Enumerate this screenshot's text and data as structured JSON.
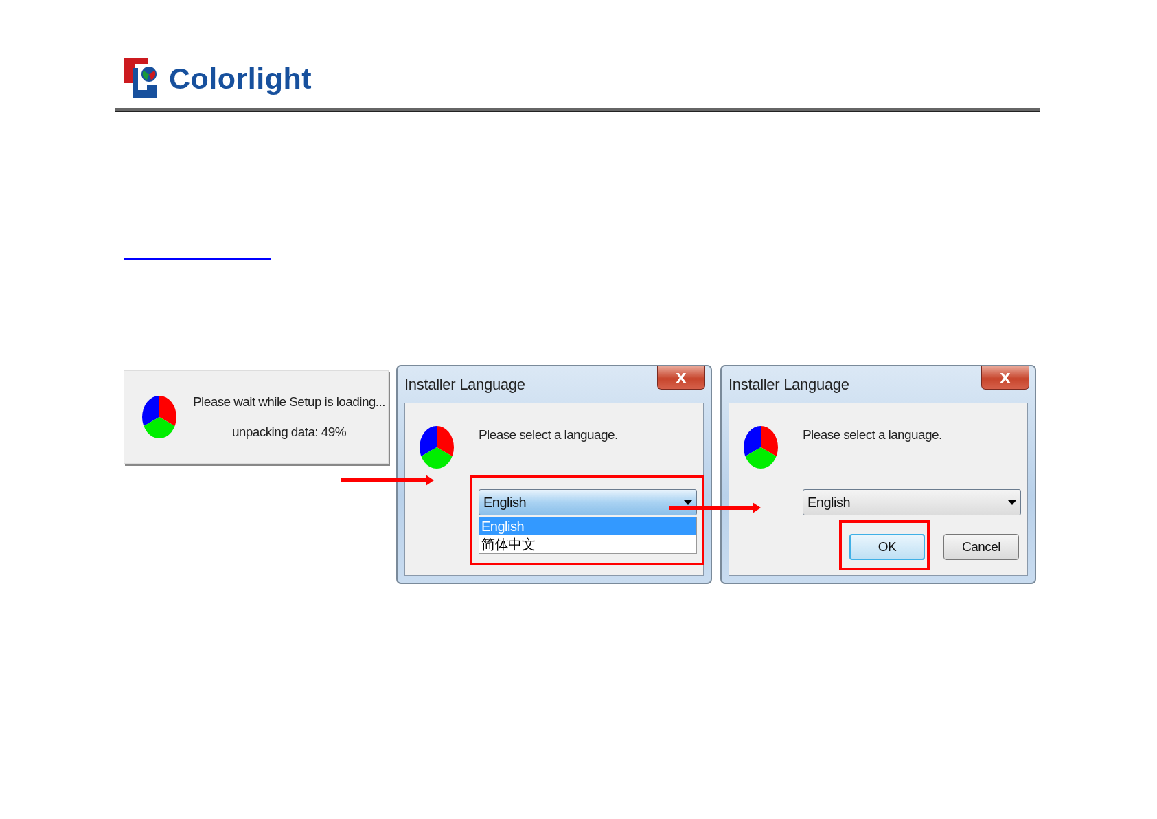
{
  "header": {
    "logo_text": "Colorlight"
  },
  "splash": {
    "message": "Please wait while Setup is loading...",
    "progress": "unpacking data: 49%"
  },
  "dialogs": [
    {
      "title": "Installer Language",
      "close": "X",
      "prompt": "Please select a language.",
      "combo": {
        "value": "English",
        "expanded": true,
        "highlighted": true,
        "options": [
          {
            "label": "English",
            "selected": true
          },
          {
            "label": "简体中文",
            "selected": false
          }
        ]
      }
    },
    {
      "title": "Installer Language",
      "close": "X",
      "prompt": "Please select a language.",
      "combo": {
        "value": "English",
        "expanded": false,
        "highlighted": false
      },
      "buttons": [
        {
          "label": "OK",
          "kind": "ok",
          "highlighted": true
        },
        {
          "label": "Cancel",
          "kind": "cancel",
          "highlighted": false
        }
      ]
    }
  ]
}
